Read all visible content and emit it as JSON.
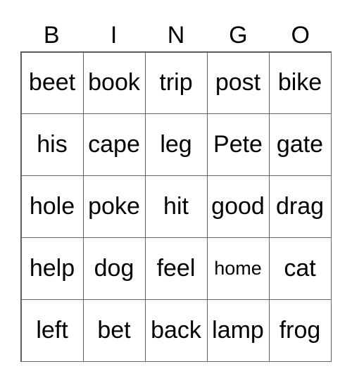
{
  "header": [
    "B",
    "I",
    "N",
    "G",
    "O"
  ],
  "cells": [
    [
      "beet",
      "book",
      "trip",
      "post",
      "bike"
    ],
    [
      "his",
      "cape",
      "leg",
      "Pete",
      "gate"
    ],
    [
      "hole",
      "poke",
      "hit",
      "good",
      "drag"
    ],
    [
      "help",
      "dog",
      "feel",
      "home",
      "cat"
    ],
    [
      "left",
      "bet",
      "back",
      "lamp",
      "frog"
    ]
  ]
}
